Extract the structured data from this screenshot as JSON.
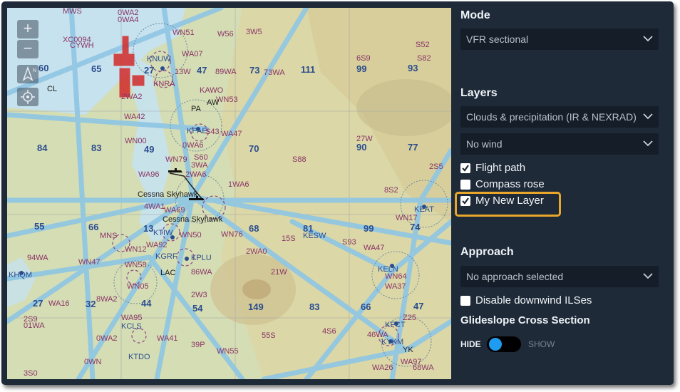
{
  "map": {
    "zoom_in": "+",
    "zoom_out": "−",
    "labels": [
      {
        "t": "MWS",
        "c": "p"
      },
      {
        "t": "0WA2",
        "c": "p"
      },
      {
        "t": "0WA4",
        "c": "p"
      },
      {
        "t": "WN51",
        "c": "p"
      },
      {
        "t": "XC0094",
        "c": "p"
      },
      {
        "t": "CYWH",
        "c": "p"
      },
      {
        "t": "KNUW",
        "c": "b"
      },
      {
        "t": "WA07",
        "c": "p"
      },
      {
        "t": "W56",
        "c": "p"
      },
      {
        "t": "3W5",
        "c": "p"
      },
      {
        "t": "S52",
        "c": "p"
      },
      {
        "t": "6S9",
        "c": "p"
      },
      {
        "t": "S82",
        "c": "p"
      },
      {
        "t": "13W",
        "c": "p"
      },
      {
        "t": "89WA",
        "c": "p"
      },
      {
        "t": "73",
        "c": "b"
      },
      {
        "t": "73WA",
        "c": "p"
      },
      {
        "t": "111",
        "c": "b"
      },
      {
        "t": "99",
        "c": "b"
      },
      {
        "t": "93",
        "c": "b"
      },
      {
        "t": "60",
        "c": "b"
      },
      {
        "t": "65",
        "c": "b"
      },
      {
        "t": "27",
        "c": "b"
      },
      {
        "t": "47",
        "c": "b"
      },
      {
        "t": "CL",
        "c": "k"
      },
      {
        "t": "KNRA",
        "c": "p"
      },
      {
        "t": "KAWO",
        "c": "p"
      },
      {
        "t": "WN53",
        "c": "p"
      },
      {
        "t": "2WA2",
        "c": "p"
      },
      {
        "t": "WA42",
        "c": "p"
      },
      {
        "t": "AW",
        "c": "k"
      },
      {
        "t": "PA",
        "c": "k"
      },
      {
        "t": "KPAE",
        "c": "b"
      },
      {
        "t": "S43",
        "c": "p"
      },
      {
        "t": "WA47",
        "c": "p"
      },
      {
        "t": "WN00",
        "c": "p"
      },
      {
        "t": "0WA6",
        "c": "p"
      },
      {
        "t": "84",
        "c": "b"
      },
      {
        "t": "83",
        "c": "b"
      },
      {
        "t": "49",
        "c": "b"
      },
      {
        "t": "70",
        "c": "b"
      },
      {
        "t": "S88",
        "c": "p"
      },
      {
        "t": "90",
        "c": "b"
      },
      {
        "t": "77",
        "c": "b"
      },
      {
        "t": "27W",
        "c": "p"
      },
      {
        "t": "S60",
        "c": "p"
      },
      {
        "t": "WN79",
        "c": "p"
      },
      {
        "t": "3WA",
        "c": "p"
      },
      {
        "t": "WA96",
        "c": "p"
      },
      {
        "t": "2WA6",
        "c": "p"
      },
      {
        "t": "2S5",
        "c": "p"
      },
      {
        "t": "1WA6",
        "c": "p"
      },
      {
        "t": "Cessna Skyhawk",
        "c": "k"
      },
      {
        "t": "4WA1",
        "c": "p"
      },
      {
        "t": "8S2",
        "c": "p"
      },
      {
        "t": "WA69",
        "c": "p"
      },
      {
        "t": "Cessna Skyhawk",
        "c": "k"
      },
      {
        "t": "KEAT",
        "c": "b"
      },
      {
        "t": "WN17",
        "c": "p"
      },
      {
        "t": "55",
        "c": "b"
      },
      {
        "t": "66",
        "c": "b"
      },
      {
        "t": "13",
        "c": "b"
      },
      {
        "t": "KTIW",
        "c": "b"
      },
      {
        "t": "WN50",
        "c": "p"
      },
      {
        "t": "68",
        "c": "b"
      },
      {
        "t": "81",
        "c": "b"
      },
      {
        "t": "99",
        "c": "b"
      },
      {
        "t": "74",
        "c": "b"
      },
      {
        "t": "MNS",
        "c": "p"
      },
      {
        "t": "KESW",
        "c": "b"
      },
      {
        "t": "15S",
        "c": "p"
      },
      {
        "t": "WN76",
        "c": "p"
      },
      {
        "t": "S93",
        "c": "p"
      },
      {
        "t": "WA92",
        "c": "p"
      },
      {
        "t": "WN12",
        "c": "p"
      },
      {
        "t": "2WA0",
        "c": "p"
      },
      {
        "t": "WA47",
        "c": "p"
      },
      {
        "t": "94WA",
        "c": "p"
      },
      {
        "t": "WN47",
        "c": "p"
      },
      {
        "t": "KGRF",
        "c": "b"
      },
      {
        "t": "KPLU",
        "c": "b"
      },
      {
        "t": "WN58",
        "c": "p"
      },
      {
        "t": "KELN",
        "c": "b"
      },
      {
        "t": "WN64",
        "c": "p"
      },
      {
        "t": "KHQM",
        "c": "b"
      },
      {
        "t": "LAC",
        "c": "k"
      },
      {
        "t": "86WA",
        "c": "p"
      },
      {
        "t": "21W",
        "c": "p"
      },
      {
        "t": "WA37",
        "c": "p"
      },
      {
        "t": "8WA2",
        "c": "p"
      },
      {
        "t": "WN05",
        "c": "p"
      },
      {
        "t": "27",
        "c": "b"
      },
      {
        "t": "WA16",
        "c": "p"
      },
      {
        "t": "32",
        "c": "b"
      },
      {
        "t": "44",
        "c": "b"
      },
      {
        "t": "2W3",
        "c": "p"
      },
      {
        "t": "54",
        "c": "b"
      },
      {
        "t": "149",
        "c": "b"
      },
      {
        "t": "83",
        "c": "b"
      },
      {
        "t": "66",
        "c": "b"
      },
      {
        "t": "47",
        "c": "b"
      },
      {
        "t": "2S9",
        "c": "p"
      },
      {
        "t": "WA95",
        "c": "p"
      },
      {
        "t": "Z25",
        "c": "p"
      },
      {
        "t": "01WA",
        "c": "p"
      },
      {
        "t": "KCLS",
        "c": "b"
      },
      {
        "t": "KFCT",
        "c": "b"
      },
      {
        "t": "0WA2",
        "c": "p"
      },
      {
        "t": "WA41",
        "c": "p"
      },
      {
        "t": "4S6",
        "c": "p"
      },
      {
        "t": "55S",
        "c": "p"
      },
      {
        "t": "46WA",
        "c": "p"
      },
      {
        "t": "KYKM",
        "c": "b"
      },
      {
        "t": "YK",
        "c": "k"
      },
      {
        "t": "39P",
        "c": "p"
      },
      {
        "t": "WN55",
        "c": "p"
      },
      {
        "t": "WA97",
        "c": "p"
      },
      {
        "t": "KTDO",
        "c": "b"
      },
      {
        "t": "WA26",
        "c": "p"
      },
      {
        "t": "68WA",
        "c": "p"
      },
      {
        "t": "3S0",
        "c": "p"
      },
      {
        "t": "0WN",
        "c": "p"
      }
    ]
  },
  "panel": {
    "mode_title": "Mode",
    "mode_value": "VFR sectional",
    "layers_title": "Layers",
    "clouds_value": "Clouds & precipitation (IR & NEXRAD)",
    "wind_value": "No wind",
    "flight_path_label": "Flight path",
    "compass_rose_label": "Compass rose",
    "my_new_layer_label": "My New Layer",
    "approach_title": "Approach",
    "approach_value": "No approach selected",
    "disable_downwind_label": "Disable downwind ILSes",
    "glideslope_title": "Glideslope Cross Section",
    "hide_label": "HIDE",
    "show_label": "SHOW"
  },
  "state": {
    "flight_path_checked": true,
    "compass_rose_checked": false,
    "my_new_layer_checked": true,
    "disable_downwind_checked": false,
    "glideslope_show": false
  },
  "colors": {
    "panel_bg": "#1e2a38",
    "dropdown_bg": "#141d28",
    "highlight": "#e8a72a",
    "toggle_knob": "#1f9cf0",
    "airway": "#8ec6e4",
    "water": "#c6e2ee",
    "label_purple": "#8a3566",
    "label_blue": "#2b4d8e"
  }
}
